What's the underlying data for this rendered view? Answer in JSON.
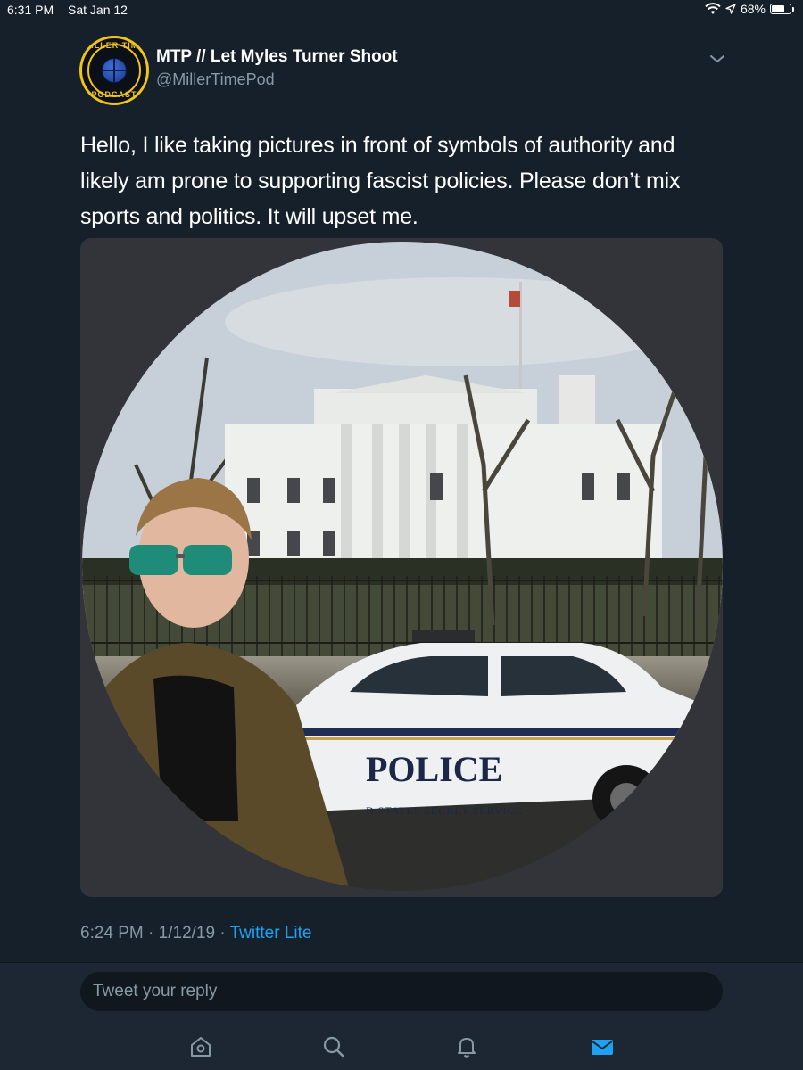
{
  "status_bar": {
    "time": "6:31 PM",
    "date": "Sat Jan 12",
    "battery_text": "68%",
    "battery_level": 0.68,
    "icons": [
      "wifi-icon",
      "location-arrow-icon",
      "battery-icon"
    ]
  },
  "tweet": {
    "avatar_text_top": "MILLER TIME",
    "avatar_text_bottom": "PODCAST",
    "display_name": "MTP // Let Myles Turner Shoot",
    "handle": "@MillerTimePod",
    "text": "Hello, I like taking pictures in front of symbols of authority and likely am prone to supporting fascist policies. Please don’t mix sports and politics. It will upset me.",
    "media": {
      "police_text": "POLICE",
      "car_subtext": "D STATES SECRET SERVICE"
    },
    "time": "6:24 PM",
    "date": "1/12/19",
    "separator": "·",
    "source": "Twitter Lite"
  },
  "reply": {
    "placeholder": "Tweet your reply"
  },
  "tab_bar": {
    "active_tab": "messages",
    "accent_color": "#1da1f2",
    "icon_color": "#8899a6"
  },
  "colors": {
    "background": "#15202b",
    "secondary_text": "#8899a6",
    "link": "#1da1f2"
  }
}
